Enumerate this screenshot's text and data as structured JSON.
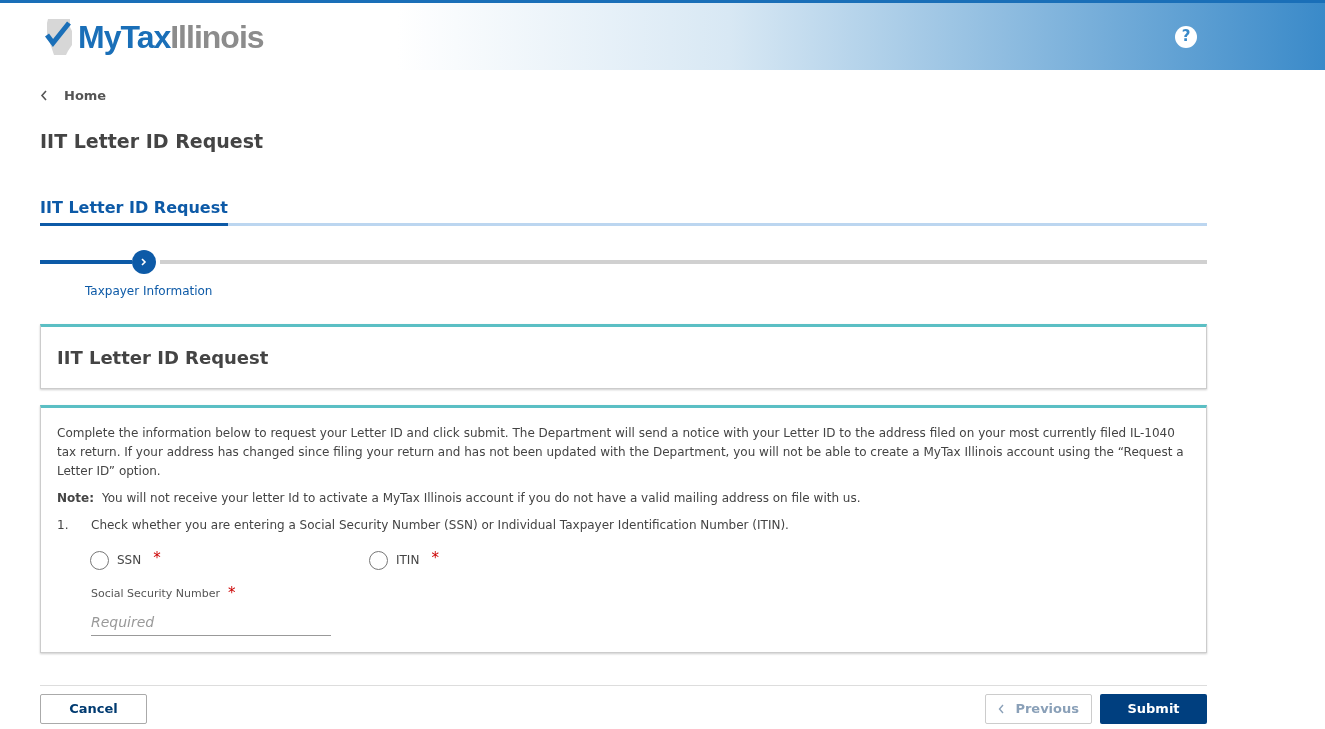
{
  "header": {
    "logo_primary": "MyTax",
    "logo_secondary": "Illinois",
    "help_icon": "?"
  },
  "breadcrumb": {
    "label": "Home"
  },
  "page_title": "IIT Letter ID Request",
  "section_tab": {
    "label": "IIT Letter ID Request",
    "selected": true
  },
  "steps": [
    {
      "label": "Taxpayer Information",
      "selected": true
    }
  ],
  "form_title": "IIT Letter ID Request",
  "intro": "Complete the information below to request your Letter ID and click submit. The Department will send a notice with your Letter ID to the address filed on your most currently filed IL-1040 tax return. If your address has changed since filing your return and has not been updated with the Department, you will not be able to create a MyTax Illinois account using the “Request a Letter ID” option.",
  "note": {
    "label": "Note:",
    "text": "You will not receive your letter Id to activate a MyTax Illinois account if you do not have a valid mailing address on file with us."
  },
  "question": {
    "number": "1.",
    "text": "Check whether you are entering a Social Security Number (SSN) or Individual Taxpayer Identification Number (ITIN).",
    "options": [
      {
        "label": "SSN",
        "required_mark": "*",
        "checked": false
      },
      {
        "label": "ITIN",
        "required_mark": "*",
        "checked": false
      }
    ]
  },
  "field": {
    "label": "Social Security Number",
    "required_mark": "*",
    "placeholder": "Required"
  },
  "buttons": {
    "cancel": "Cancel",
    "previous": {
      "label": "Previous",
      "disabled": true
    },
    "submit": "Submit"
  }
}
